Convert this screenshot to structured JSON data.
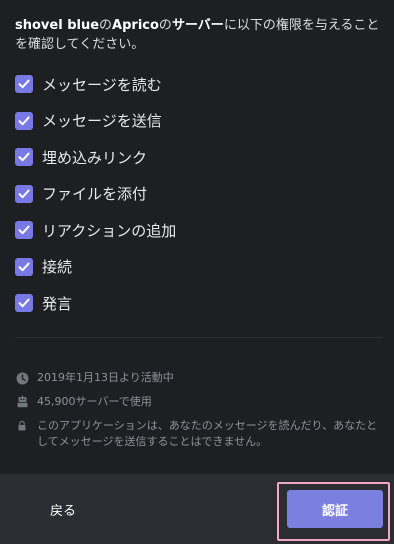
{
  "intro": {
    "user": "shovel blue",
    "particle1": "の",
    "bot": "Aprico",
    "particle2": "の",
    "server_word": "サーバー",
    "rest": "に以下の権限を与えることを確認してください。"
  },
  "permissions": [
    {
      "label": "メッセージを読む",
      "checked": true
    },
    {
      "label": "メッセージを送信",
      "checked": true
    },
    {
      "label": "埋め込みリンク",
      "checked": true
    },
    {
      "label": "ファイルを添付",
      "checked": true
    },
    {
      "label": "リアクションの追加",
      "checked": true
    },
    {
      "label": "接続",
      "checked": true
    },
    {
      "label": "発言",
      "checked": true
    }
  ],
  "meta": {
    "since": "2019年1月13日より活動中",
    "servers": "45,900サーバーで使用",
    "notice": "このアプリケーションは、あなたのメッセージを読んだり、あなたとしてメッセージを送信することはできません。"
  },
  "footer": {
    "back_label": "戻る",
    "auth_label": "認証"
  },
  "colors": {
    "accent": "#7b7fe0",
    "checkbox": "#7979e6",
    "background": "#1e1f23",
    "footer": "#2b2d32",
    "highlight": "#f0a8c8"
  }
}
